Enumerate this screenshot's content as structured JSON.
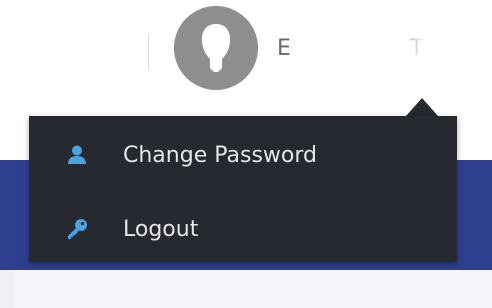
{
  "header": {
    "user_name": "E T",
    "avatar_icon": "user-silhouette-icon"
  },
  "dropdown": {
    "items": [
      {
        "label": "Change Password",
        "icon": "user-icon"
      },
      {
        "label": "Logout",
        "icon": "key-icon"
      }
    ]
  },
  "colors": {
    "dropdown_bg": "#262a30",
    "icon_accent": "#4aa3df",
    "band": "#2e3f8f"
  }
}
